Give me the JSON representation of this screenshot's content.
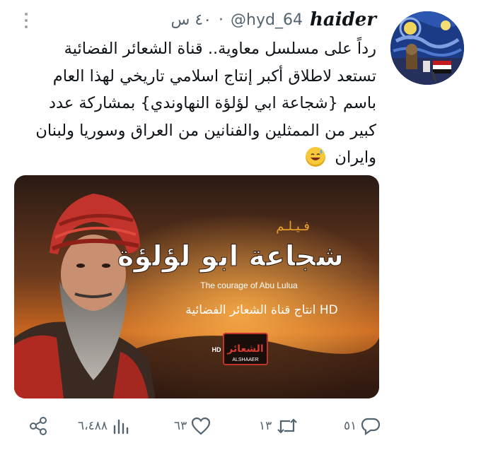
{
  "tweet": {
    "display_name": "haider",
    "handle": "@hyd_64",
    "separator": "·",
    "timestamp": "٤٠ س",
    "body_lines": [
      "رداً على مسلسل معاوية.. قناة الشعائر الفضائية",
      "تستعد لاطلاق أكبر إنتاج اسلامي تاريخي لهذا العام",
      "باسم {شجاعة ابي لؤلؤة النهاوندي} بمشاركة عدد",
      "كبير من الممثلين والفنانين من العراق وسوريا ولبنان",
      "وايران"
    ],
    "emoji": "sweat-smile-emoji"
  },
  "media": {
    "film_label": "فـيـلـم",
    "title_ar": "شجاعة ابو لؤلؤة",
    "title_en": "The courage of Abu Lulua",
    "production_line": "انتاج قناة الشعائر الفضائية HD",
    "logo_hd": "HD",
    "logo_text_ar": "الشعائر",
    "logo_text_en": "ALSHAAER"
  },
  "actions": {
    "replies": "٥١",
    "retweets": "١٣",
    "likes": "٦٣",
    "views": "٦،٤٨٨"
  },
  "colors": {
    "text": "#0f1419",
    "muted": "#536471",
    "turban": "#c2332b",
    "sky": "#e07a26"
  }
}
